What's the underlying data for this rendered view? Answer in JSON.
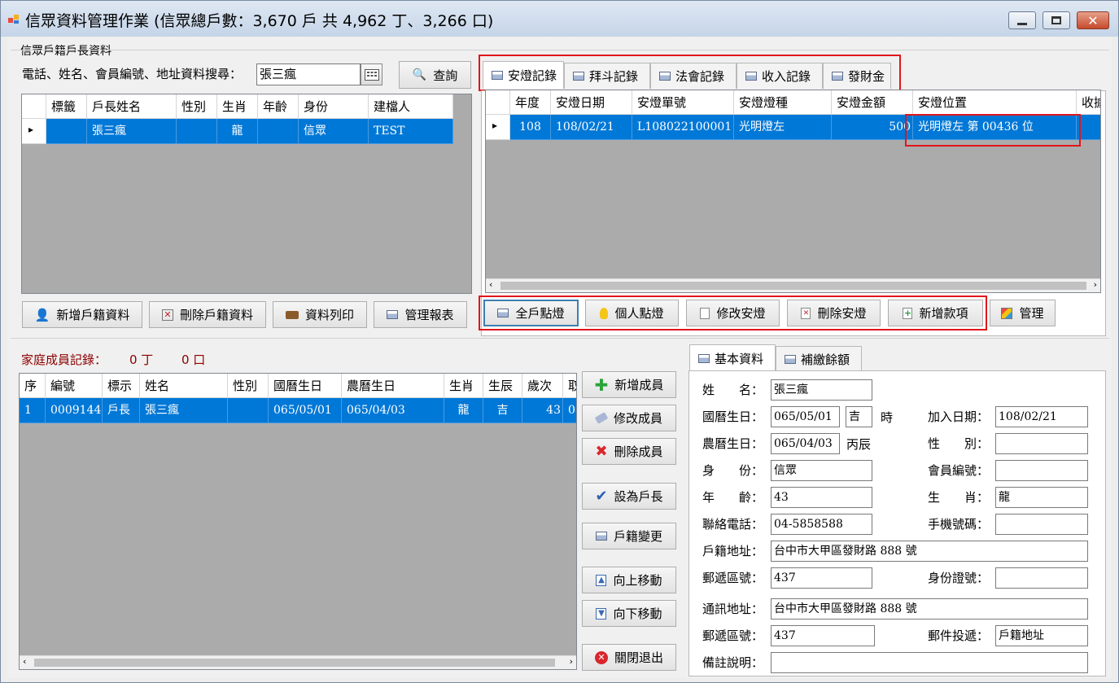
{
  "window": {
    "title": "信眾資料管理作業 (信眾總戶數：3,670 戶  共 4,962 丁、3,266 口)"
  },
  "head_section": {
    "group_label": "信眾戶籍戶長資料",
    "search_label": "電話、姓名、會員編號、地址資料搜尋：",
    "search_value": "張三瘋",
    "query_button": "查詢",
    "columns": [
      "標籤",
      "戶長姓名",
      "性別",
      "生肖",
      "年齡",
      "身份",
      "建檔人"
    ],
    "rows": [
      [
        "",
        "張三瘋",
        "",
        "龍",
        "",
        "信眾",
        "TEST"
      ]
    ],
    "buttons": {
      "add": "新增戶籍資料",
      "delete": "刪除戶籍資料",
      "print": "資料列印",
      "report": "管理報表"
    }
  },
  "records": {
    "tabs": [
      "安燈記錄",
      "拜斗記錄",
      "法會記錄",
      "收入記錄",
      "發財金"
    ],
    "columns": [
      "年度",
      "安燈日期",
      "安燈單號",
      "安燈燈種",
      "安燈金額",
      "安燈位置",
      "收據"
    ],
    "rows": [
      [
        "108",
        "108/02/21",
        "L108022100001",
        "光明燈左",
        "500",
        "光明燈左 第 00436 位",
        ""
      ]
    ],
    "buttons": {
      "all": "全戶點燈",
      "personal": "個人點燈",
      "edit": "修改安燈",
      "delete": "刪除安燈",
      "add_item": "新增款項",
      "manage": "管理"
    }
  },
  "family": {
    "title": "家庭成員記錄：",
    "ding": "0 丁",
    "kou": "0 口",
    "columns": [
      "序",
      "編號",
      "標示",
      "姓名",
      "性別",
      "國曆生日",
      "農曆生日",
      "生肖",
      "生辰",
      "歲次",
      "取"
    ],
    "rows": [
      [
        "1",
        "0009144",
        "戶長",
        "張三瘋",
        "",
        "065/05/01",
        "065/04/03",
        "龍",
        "吉",
        "43",
        "0"
      ]
    ],
    "buttons": {
      "add": "新增成員",
      "edit": "修改成員",
      "delete": "刪除成員",
      "set_head": "設為戶長",
      "change": "戶籍變更",
      "up": "向上移動",
      "down": "向下移動",
      "close": "關閉退出"
    }
  },
  "detail": {
    "tabs": [
      "基本資料",
      "補繳餘額"
    ],
    "labels": {
      "name": "姓　　名：",
      "solar": "國曆生日：",
      "hour": "時",
      "join": "加入日期：",
      "lunar": "農曆生日：",
      "gender": "性　　別：",
      "identity": "身　　份：",
      "member": "會員編號：",
      "age": "年　　齡：",
      "zodiac": "生　　肖：",
      "phone": "聯絡電話：",
      "mobile": "手機號碼：",
      "address": "戶籍地址：",
      "zip": "郵遞區號：",
      "idno": "身份證號：",
      "mail_address": "通訊地址：",
      "zip2": "郵遞區號：",
      "delivery": "郵件投遞：",
      "remark": "備註說明："
    },
    "values": {
      "name": "張三瘋",
      "solar": "065/05/01",
      "hour": "吉",
      "join": "108/02/21",
      "lunar": "065/04/03",
      "lunar_year": "丙辰",
      "gender": "",
      "identity": "信眾",
      "member": "",
      "age": "43",
      "zodiac": "龍",
      "phone": "04-5858588",
      "mobile": "",
      "address": "台中市大甲區發財路 888 號",
      "zip": "437",
      "idno": "",
      "mail_address": "台中市大甲區發財路 888 號",
      "zip2": "437",
      "delivery": "戶籍地址",
      "remark": ""
    }
  },
  "colors": {
    "selection": "#0078d7",
    "highlight_box": "#e0161b",
    "family_title": "#8b0000"
  }
}
